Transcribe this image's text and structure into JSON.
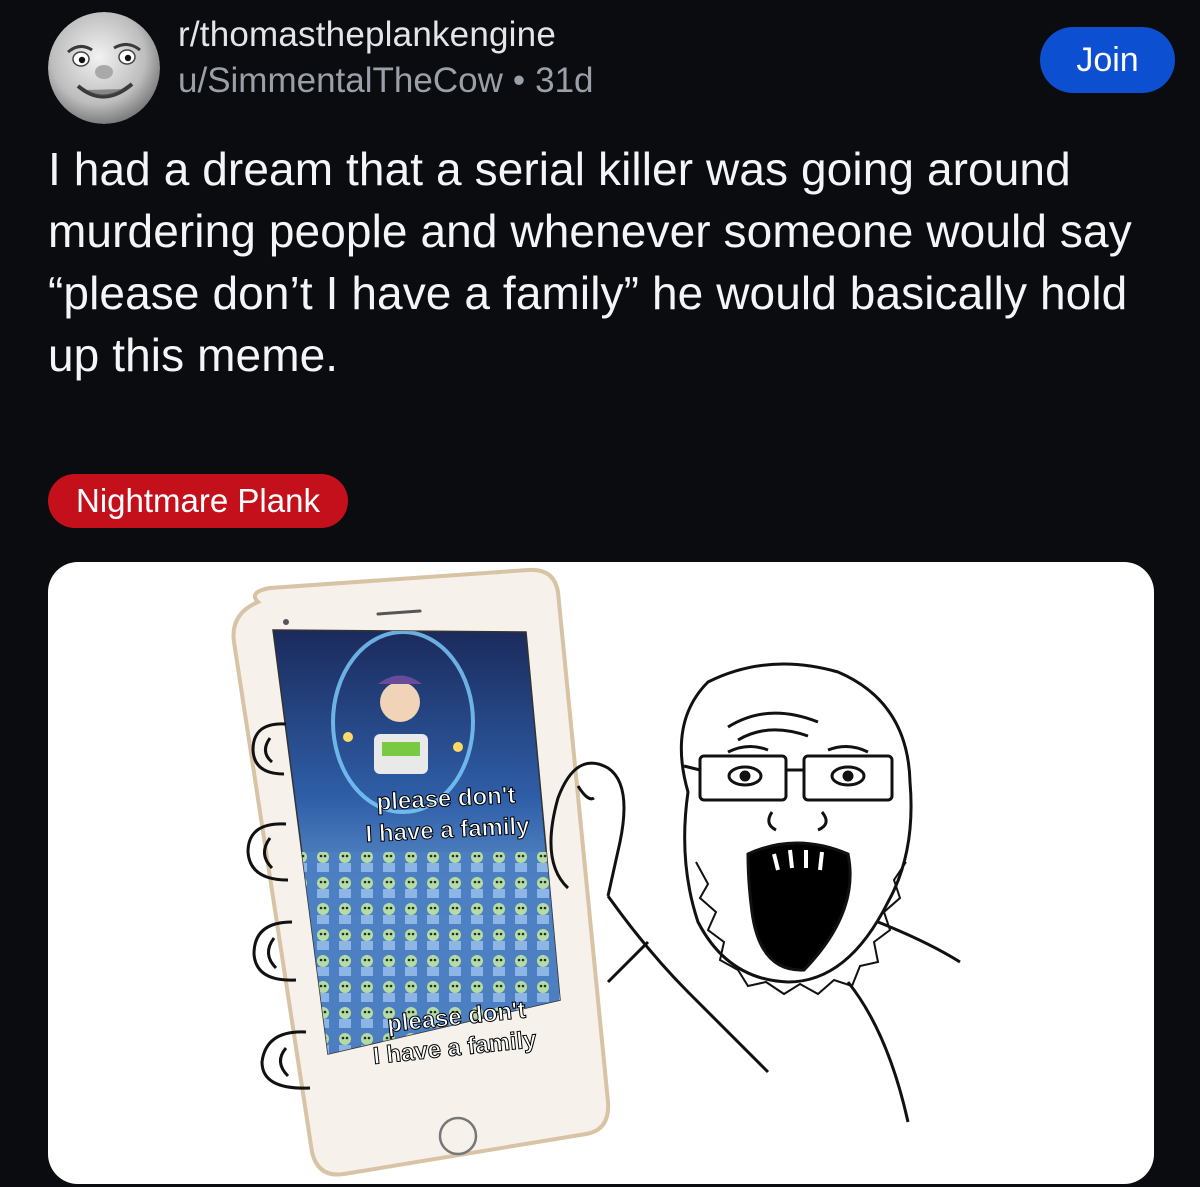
{
  "subreddit": {
    "name": "r/thomastheplankengine",
    "avatar_icon": "tank-engine-face-icon"
  },
  "post": {
    "author": "u/SimmentalTheCow",
    "separator": "•",
    "age": "31d",
    "title": "I had a dream that a serial killer was going around murdering people and whenever someone would say “please don’t I have a family” he would basically hold up this meme.",
    "flair": "Nightmare Plank",
    "image": {
      "caption_top": [
        "please don't",
        "I have a family"
      ],
      "caption_bottom": [
        "please don't",
        "I have a family"
      ]
    }
  },
  "actions": {
    "join_label": "Join"
  },
  "colors": {
    "background": "#0b0c10",
    "join_button": "#0d4fd1",
    "flair": "#c4101a",
    "byline": "#9aa0a8"
  }
}
